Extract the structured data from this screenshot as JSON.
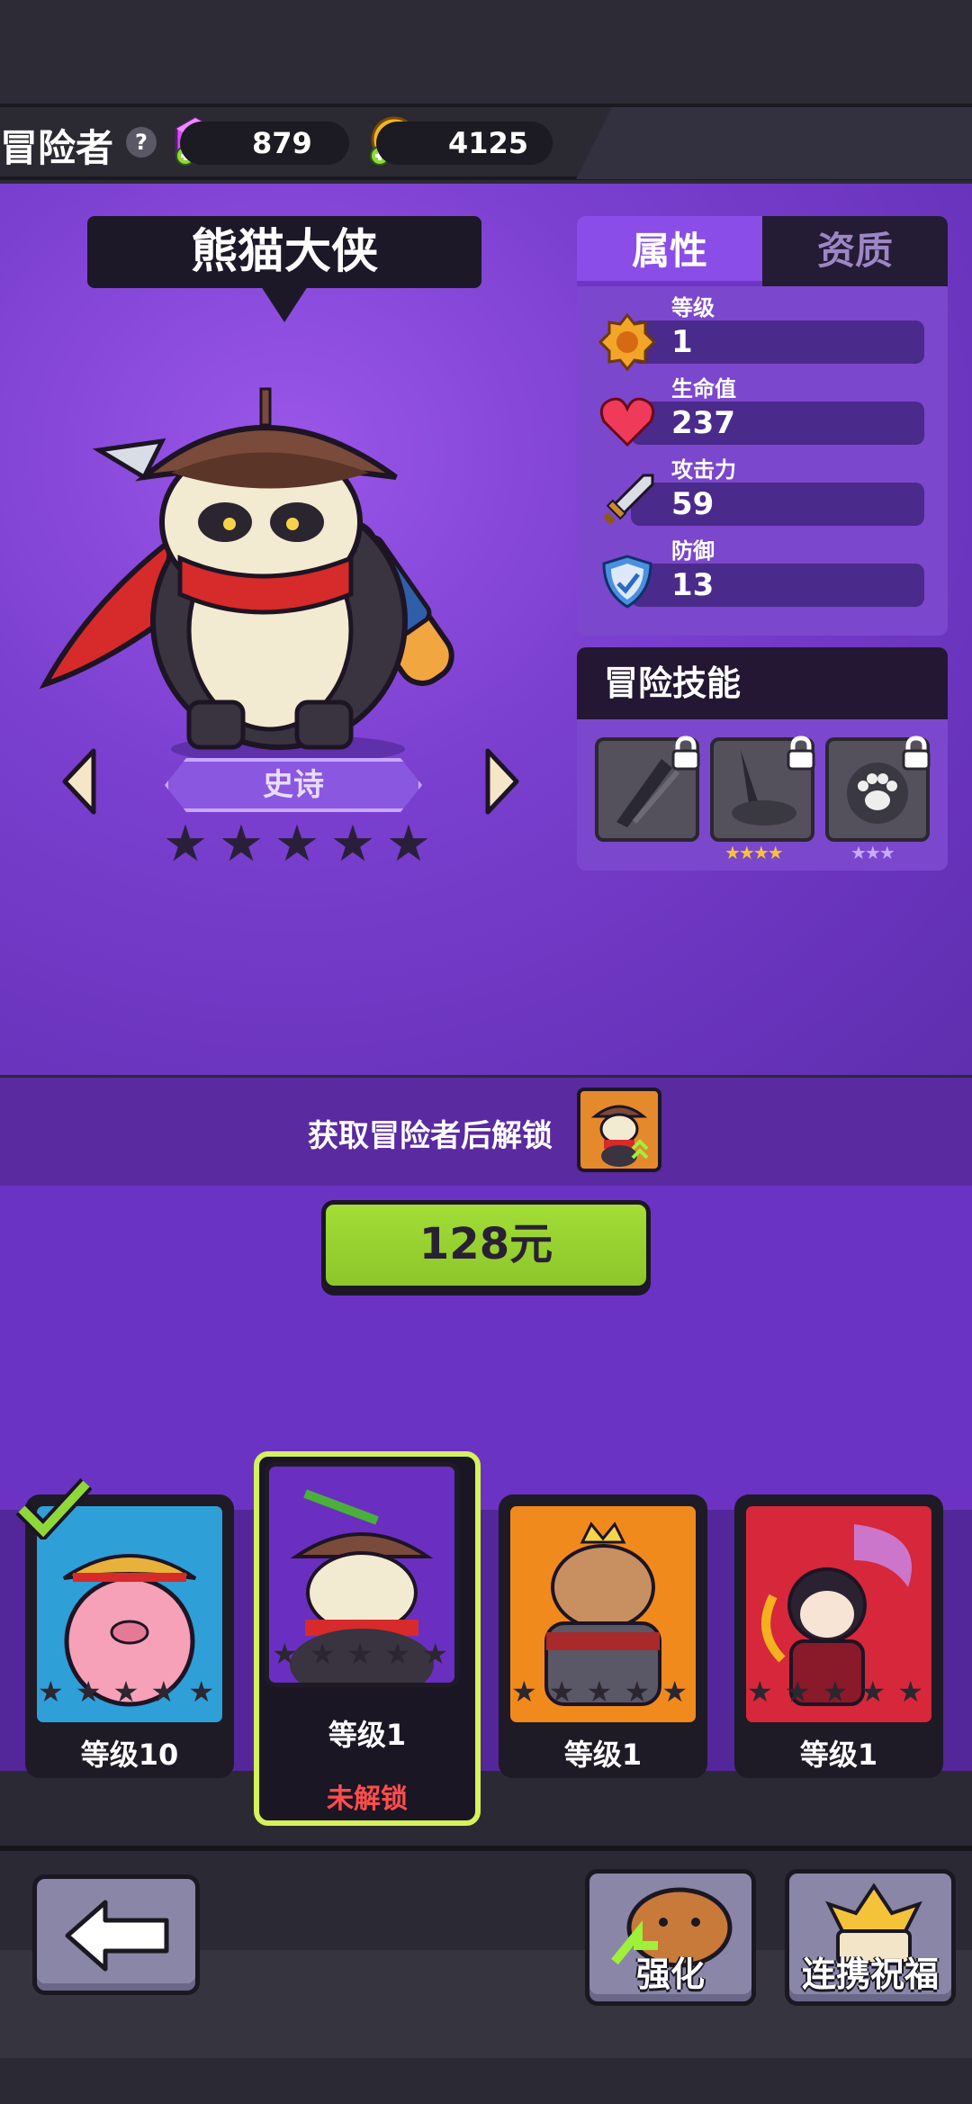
{
  "header": {
    "title": "冒险者",
    "help_icon": "?",
    "gems": "879",
    "coins": "4125"
  },
  "hero": {
    "name": "熊猫大侠",
    "rarity": "史诗",
    "stars_total": 5
  },
  "tabs": {
    "attributes": "属性",
    "aptitude": "资质"
  },
  "stats": [
    {
      "label": "等级",
      "value": "1",
      "icon": "level-badge-icon"
    },
    {
      "label": "生命值",
      "value": "237",
      "icon": "heart-icon"
    },
    {
      "label": "攻击力",
      "value": "59",
      "icon": "sword-icon"
    },
    {
      "label": "防御",
      "value": "13",
      "icon": "shield-icon"
    }
  ],
  "skills": {
    "title": "冒险技能",
    "items": [
      {
        "name": "skill-slash",
        "locked": true,
        "stars": ""
      },
      {
        "name": "skill-strike",
        "locked": true,
        "stars": "★★★★"
      },
      {
        "name": "skill-paw",
        "locked": true,
        "stars": "★★★"
      }
    ]
  },
  "unlock": {
    "text": "获取冒险者后解锁"
  },
  "purchase": {
    "price": "128元"
  },
  "roster": [
    {
      "level": "等级10",
      "owned": true,
      "bg": "#2f9fd8"
    },
    {
      "level": "等级1",
      "status": "未解锁",
      "selected": true,
      "bg": "#6a2fc0"
    },
    {
      "level": "等级1",
      "bg": "#f08a1c"
    },
    {
      "level": "等级1",
      "bg": "#d6283a"
    }
  ],
  "footer": {
    "upgrade": "强化",
    "bond": "连携祝福"
  }
}
